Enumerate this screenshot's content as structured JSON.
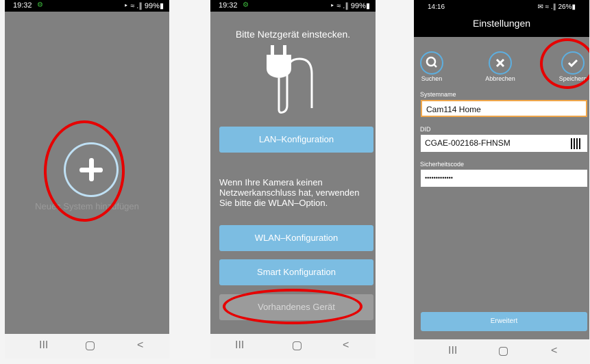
{
  "phone1": {
    "status": {
      "time": "19:32",
      "right": "‣ ≈ .∥ 99%▮"
    },
    "add_label": "Neues System hinzufügen"
  },
  "phone2": {
    "status": {
      "time": "19:32",
      "right": "‣ ≈ .∥ 99%▮"
    },
    "title": "Bitte Netzgerät einstecken.",
    "btn_lan": "LAN–Konfiguration",
    "info_text": "Wenn Ihre Kamera keinen Netzwerkanschluss hat, verwenden Sie bitte die WLAN–Option.",
    "btn_wlan": "WLAN–Konfiguration",
    "btn_smart": "Smart Konfiguration",
    "btn_existing": "Vorhandenes Gerät"
  },
  "phone3": {
    "status": {
      "time": "14:16",
      "right": "✉ ≈ .∥ 26%▮"
    },
    "title": "Einstellungen",
    "tool_search": "Suchen",
    "tool_cancel": "Abbrechen",
    "tool_save": "Speichern",
    "label_name": "Systemname",
    "value_name": "Cam114 Home",
    "label_did": "DID",
    "value_did": "CGAE-002168-FHNSM",
    "label_code": "Sicherheitscode",
    "value_code": "•••••••••••••",
    "btn_advanced": "Erweitert"
  },
  "nav": {
    "recent": "III",
    "back": "<"
  },
  "colors": {
    "accent": "#7cbde2",
    "highlight": "#e60000",
    "panel": "#808080"
  }
}
